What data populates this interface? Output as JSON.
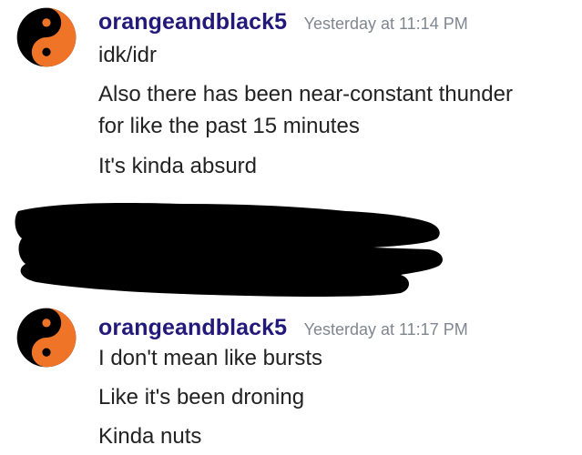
{
  "messages": [
    {
      "username": "orangeandblack5",
      "timestamp": "Yesterday at 11:14 PM",
      "lines": [
        "idk/idr",
        "Also there has been near-constant thunder",
        "for like the past 15 minutes",
        "It's kinda absurd"
      ]
    },
    {
      "username": "orangeandblack5",
      "timestamp": "Yesterday at 11:17 PM",
      "lines": [
        "I don't mean like bursts",
        "Like it's been droning",
        "Kinda nuts"
      ]
    }
  ],
  "colors": {
    "username": "#22197a",
    "timestamp": "#7f868f",
    "text": "#222222",
    "avatar_orange": "#f07427",
    "avatar_black": "#000000",
    "redaction": "#000000"
  },
  "icons": {
    "avatar": "yin-yang-icon"
  }
}
